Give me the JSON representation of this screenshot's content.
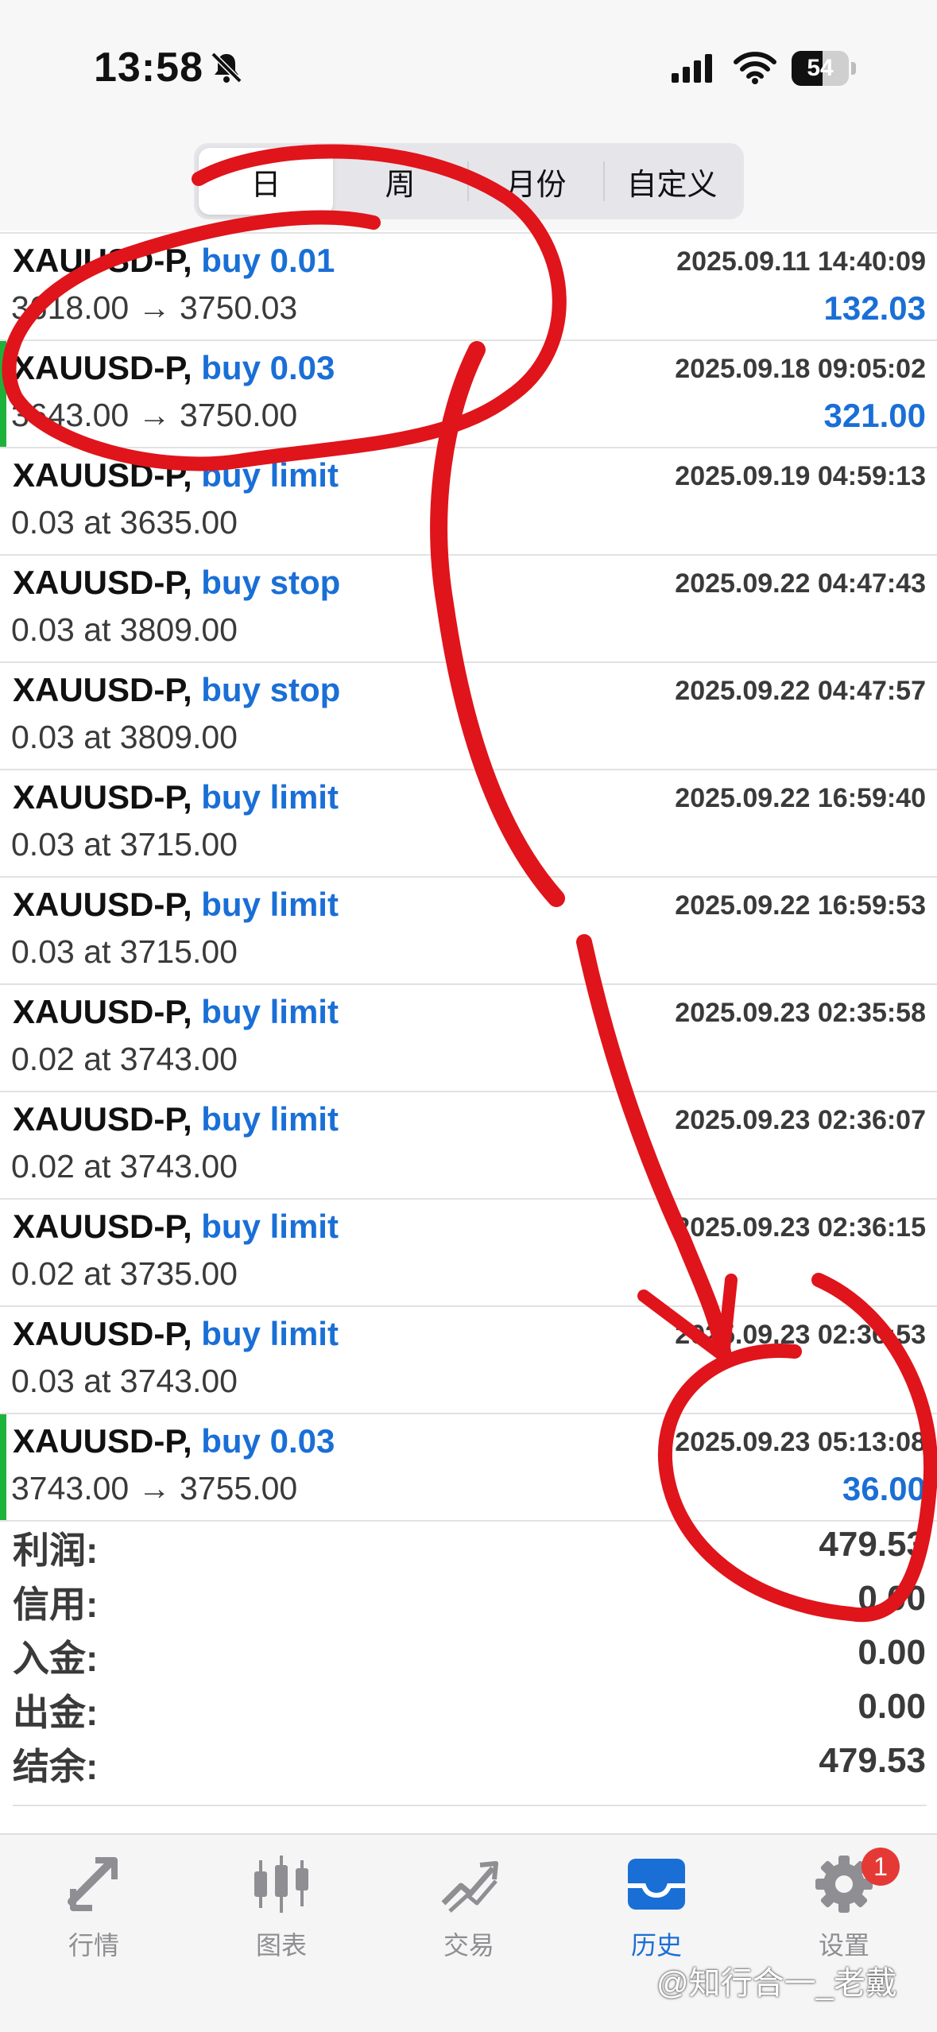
{
  "status_bar": {
    "time": "13:58",
    "battery": "54",
    "battery_level": 0.54,
    "icons": [
      "bell-slash-icon",
      "signal-icon",
      "wifi-icon",
      "battery-icon"
    ]
  },
  "tabs_period": [
    {
      "label": "日",
      "active": true
    },
    {
      "label": "周",
      "active": false
    },
    {
      "label": "月份",
      "active": false
    },
    {
      "label": "自定义",
      "active": false
    }
  ],
  "orders": [
    {
      "symbol": "XAUUSD-P,",
      "op": "buy 0.01",
      "time": "2025.09.11 14:40:09",
      "detail": "3618.00 → 3750.03",
      "profit": "132.03",
      "accent": false
    },
    {
      "symbol": "XAUUSD-P,",
      "op": "buy 0.03",
      "time": "2025.09.18 09:05:02",
      "detail": "3643.00 → 3750.00",
      "profit": "321.00",
      "accent": true
    },
    {
      "symbol": "XAUUSD-P,",
      "op": "buy limit",
      "time": "2025.09.19 04:59:13",
      "detail": "0.03 at 3635.00",
      "profit": "",
      "accent": false
    },
    {
      "symbol": "XAUUSD-P,",
      "op": "buy stop",
      "time": "2025.09.22 04:47:43",
      "detail": "0.03 at 3809.00",
      "profit": "",
      "accent": false
    },
    {
      "symbol": "XAUUSD-P,",
      "op": "buy stop",
      "time": "2025.09.22 04:47:57",
      "detail": "0.03 at 3809.00",
      "profit": "",
      "accent": false
    },
    {
      "symbol": "XAUUSD-P,",
      "op": "buy limit",
      "time": "2025.09.22 16:59:40",
      "detail": "0.03 at 3715.00",
      "profit": "",
      "accent": false
    },
    {
      "symbol": "XAUUSD-P,",
      "op": "buy limit",
      "time": "2025.09.22 16:59:53",
      "detail": "0.03 at 3715.00",
      "profit": "",
      "accent": false
    },
    {
      "symbol": "XAUUSD-P,",
      "op": "buy limit",
      "time": "2025.09.23 02:35:58",
      "detail": "0.02 at 3743.00",
      "profit": "",
      "accent": false
    },
    {
      "symbol": "XAUUSD-P,",
      "op": "buy limit",
      "time": "2025.09.23 02:36:07",
      "detail": "0.02 at 3743.00",
      "profit": "",
      "accent": false
    },
    {
      "symbol": "XAUUSD-P,",
      "op": "buy limit",
      "time": "2025.09.23 02:36:15",
      "detail": "0.02 at 3735.00",
      "profit": "",
      "accent": false
    },
    {
      "symbol": "XAUUSD-P,",
      "op": "buy limit",
      "time": "2025.09.23 02:36:53",
      "detail": "0.03 at 3743.00",
      "profit": "",
      "accent": false
    },
    {
      "symbol": "XAUUSD-P,",
      "op": "buy 0.03",
      "time": "2025.09.23 05:13:08",
      "detail": "3743.00 → 3755.00",
      "profit": "36.00",
      "accent": true
    }
  ],
  "summary": [
    {
      "label": "利润:",
      "value": "479.53"
    },
    {
      "label": "信用:",
      "value": "0.00"
    },
    {
      "label": "入金:",
      "value": "0.00"
    },
    {
      "label": "出金:",
      "value": "0.00"
    },
    {
      "label": "结余:",
      "value": "479.53"
    }
  ],
  "tab_bar": [
    {
      "label": "行情",
      "icon": "arrows-icon",
      "active": false
    },
    {
      "label": "图表",
      "icon": "candlestick-icon",
      "active": false
    },
    {
      "label": "交易",
      "icon": "trend-icon",
      "active": false
    },
    {
      "label": "历史",
      "icon": "inbox-icon",
      "active": true
    },
    {
      "label": "设置",
      "icon": "gear-icon",
      "active": false
    }
  ],
  "settings_badge": "1",
  "watermark": "@知行合一_老戴",
  "colors": {
    "accent_blue": "#1a6fd6",
    "accent_green": "#1db33a",
    "annotation_red": "#e0141b",
    "badge_red": "#e53935"
  }
}
